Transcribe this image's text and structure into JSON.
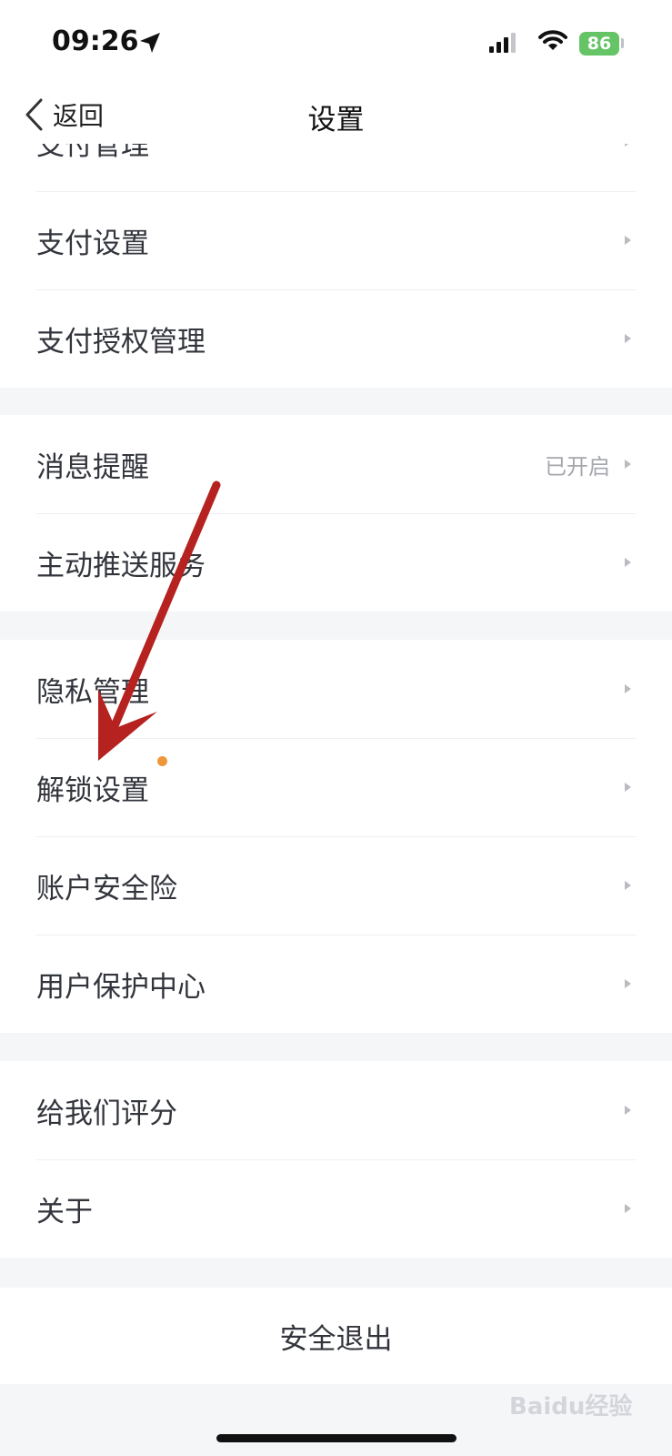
{
  "status_bar": {
    "time": "09:26",
    "battery": "86",
    "icons": [
      "location-arrow-icon",
      "signal-icon",
      "wifi-icon",
      "battery-charging-icon"
    ]
  },
  "nav": {
    "back_label": "返回",
    "title": "设置"
  },
  "groups": [
    {
      "items": [
        {
          "label": "支付管理",
          "value": ""
        },
        {
          "label": "支付设置",
          "value": ""
        },
        {
          "label": "支付授权管理",
          "value": ""
        }
      ]
    },
    {
      "items": [
        {
          "label": "消息提醒",
          "value": "已开启"
        },
        {
          "label": "主动推送服务",
          "value": ""
        }
      ]
    },
    {
      "items": [
        {
          "label": "隐私管理",
          "value": ""
        },
        {
          "label": "解锁设置",
          "value": ""
        },
        {
          "label": "账户安全险",
          "value": ""
        },
        {
          "label": "用户保护中心",
          "value": ""
        }
      ]
    },
    {
      "items": [
        {
          "label": "给我们评分",
          "value": ""
        },
        {
          "label": "关于",
          "value": ""
        }
      ]
    }
  ],
  "logout_label": "安全退出",
  "watermark": "Baidu经验",
  "colors": {
    "page_background": "#f5f6f8",
    "card_background": "#ffffff",
    "battery_green": "#65c466",
    "notification_dot": "#f0963a",
    "annotation_arrow": "#b5221f"
  }
}
